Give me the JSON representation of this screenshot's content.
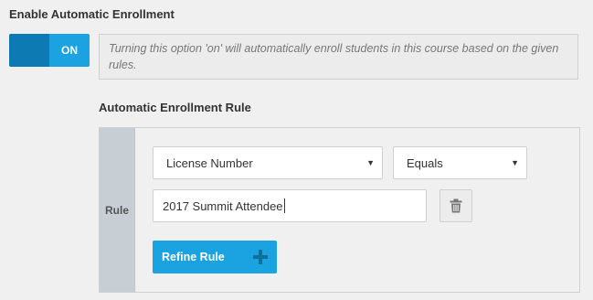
{
  "enrollment": {
    "title": "Enable Automatic Enrollment",
    "toggle_label": "ON",
    "toggle_state": "on",
    "hint": "Turning this option 'on' will automatically enroll students in this course based on the given rules."
  },
  "rule_section": {
    "title": "Automatic Enrollment Rule",
    "side_label": "Rule",
    "field_select": {
      "value": "License Number"
    },
    "operator_select": {
      "value": "Equals"
    },
    "value_input": {
      "value": "2017 Summit Attendee"
    },
    "trash_icon": "trash-icon",
    "refine_button": {
      "label": "Refine Rule",
      "icon": "plus-icon"
    }
  },
  "colors": {
    "accent": "#1aa3e0",
    "accent_dark": "#0d7ab3",
    "panel_side": "#c8cfd4"
  }
}
